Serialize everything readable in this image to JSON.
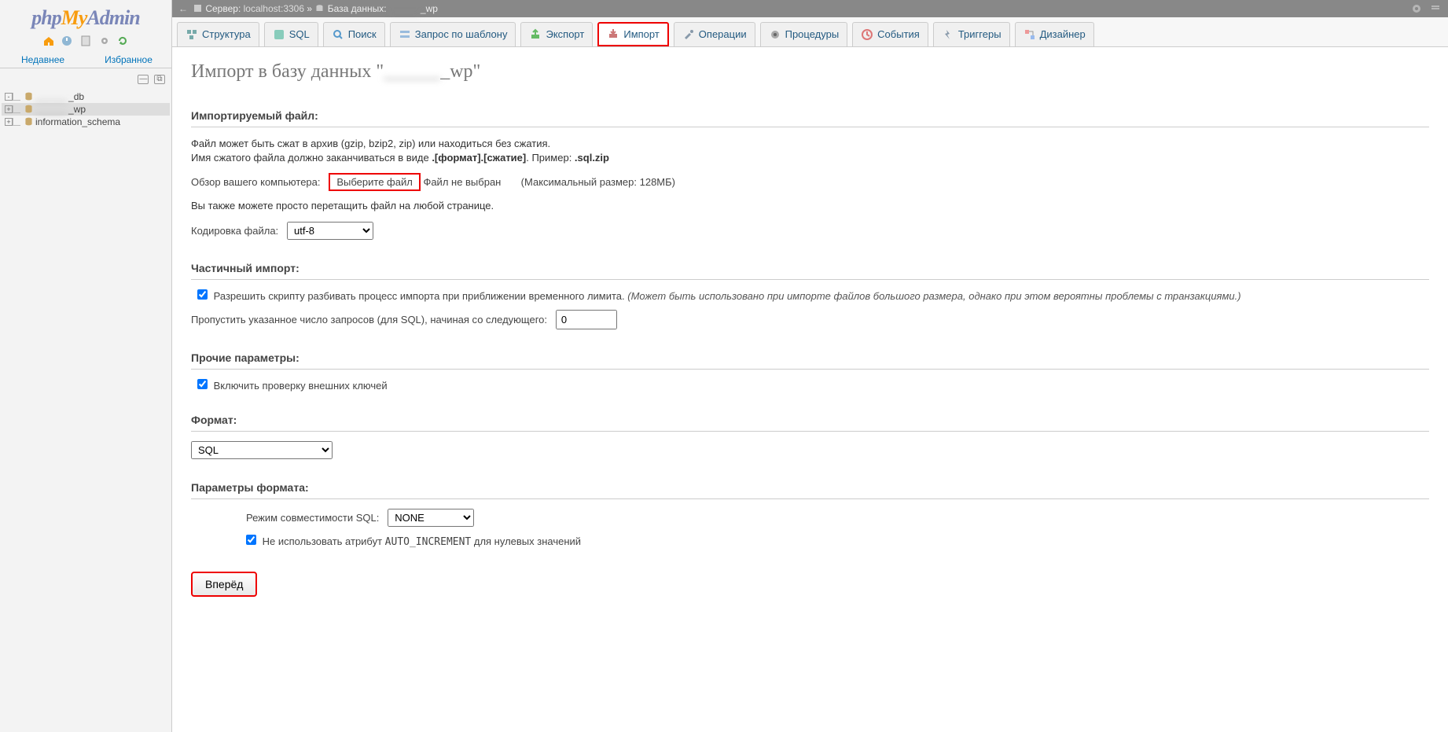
{
  "breadcrumb": {
    "server_label": "Сервер: ",
    "server_value": "localhost:3306",
    "sep": " » ",
    "db_label": "База данных: ",
    "db_value_blur": "______",
    "db_suffix": "_wp"
  },
  "sidebar": {
    "tabs": [
      "Недавнее",
      "Избранное"
    ],
    "tree": [
      {
        "name_blur": "______",
        "suffix": "_db",
        "expand": "-",
        "active": false
      },
      {
        "name_blur": "______",
        "suffix": "_wp",
        "expand": "+",
        "active": true
      },
      {
        "name": "information_schema",
        "expand": "+",
        "active": false
      }
    ]
  },
  "nav": [
    {
      "icon": "structure",
      "label": "Структура"
    },
    {
      "icon": "sql",
      "label": "SQL"
    },
    {
      "icon": "search",
      "label": "Поиск"
    },
    {
      "icon": "qbx",
      "label": "Запрос по шаблону"
    },
    {
      "icon": "export",
      "label": "Экспорт"
    },
    {
      "icon": "import",
      "label": "Импорт",
      "active": true
    },
    {
      "icon": "ops",
      "label": "Операции"
    },
    {
      "icon": "routines",
      "label": "Процедуры"
    },
    {
      "icon": "events",
      "label": "События"
    },
    {
      "icon": "triggers",
      "label": "Триггеры"
    },
    {
      "icon": "designer",
      "label": "Дизайнер"
    }
  ],
  "page": {
    "title_prefix": "Импорт в базу данных \"",
    "title_blur": "______",
    "title_suffix": "_wp\"",
    "sec_file": "Импортируемый файл:",
    "file_help1": "Файл может быть сжат в архив (gzip, bzip2, zip) или находиться без сжатия.",
    "file_help2a": "Имя сжатого файла должно заканчиваться в виде ",
    "file_help2b": ".[формат].[сжатие]",
    "file_help2c": ". Пример: ",
    "file_help2d": ".sql.zip",
    "browse_label": "Обзор вашего компьютера:",
    "choose_file": "Выберите файл",
    "no_file": "Файл не выбран",
    "max_size": "(Максимальный размер: 128МБ)",
    "dragdrop": "Вы также можете просто перетащить файл на любой странице.",
    "charset_label": "Кодировка файла:",
    "charset_value": "utf-8",
    "sec_partial": "Частичный импорт:",
    "partial_check_label": "Разрешить скрипту разбивать процесс импорта при приближении временного лимита. ",
    "partial_check_italic": "(Может быть использовано при импорте файлов большого размера, однако при этом вероятны проблемы с транзакциями.)",
    "skip_label": "Пропустить указанное число запросов (для SQL), начиная со следующего:",
    "skip_value": "0",
    "sec_other": "Прочие параметры:",
    "fk_label": "Включить проверку внешних ключей",
    "sec_format": "Формат:",
    "format_value": "SQL",
    "sec_fmtopts": "Параметры формата:",
    "compat_label": "Режим совместимости SQL:",
    "compat_value": "NONE",
    "ai_label_a": "Не использовать атрибут ",
    "ai_label_b": "AUTO_INCREMENT",
    "ai_label_c": " для нулевых значений",
    "go_btn": "Вперёд"
  }
}
